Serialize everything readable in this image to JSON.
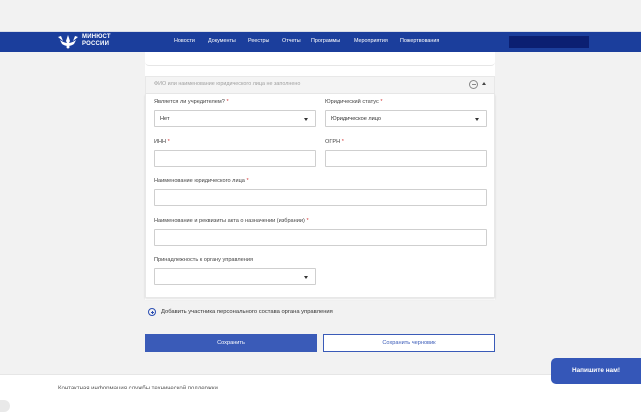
{
  "header": {
    "brand_line1": "МИНЮСТ",
    "brand_line2": "РОССИИ",
    "nav": [
      "Новости",
      "Документы",
      "Реестры",
      "Отчеты",
      "Программы",
      "Мероприятия",
      "Пожертвования"
    ]
  },
  "accordion": {
    "title": "ФИО или наименование юридического лица не заполнено"
  },
  "form": {
    "founder": {
      "label": "Является ли учредителем?",
      "value": "Нет"
    },
    "legal_status": {
      "label": "Юридический статус",
      "value": "Юридическое лицо"
    },
    "inn": {
      "label": "ИНН",
      "value": ""
    },
    "ogrn": {
      "label": "ОГРН",
      "value": ""
    },
    "org_name": {
      "label": "Наименование юридического лица",
      "value": ""
    },
    "act": {
      "label": "Наименование и реквизиты акта о назначении (избрании)",
      "value": ""
    },
    "body_membership": {
      "label": "Принадлежность к органу управления",
      "value": ""
    },
    "required_mark": "*"
  },
  "add_participant": {
    "label": "Добавить участника персонального состава органа управления"
  },
  "buttons": {
    "save": "Сохранить",
    "save_draft": "Сохранить черновик"
  },
  "chat": {
    "label": "Напишите нам!"
  },
  "footer": {
    "text": "Контактная информация службы технической поддержки"
  },
  "colors": {
    "header": "#1b3e9c",
    "accent": "#3a5bb8",
    "required": "#d43d3d"
  }
}
